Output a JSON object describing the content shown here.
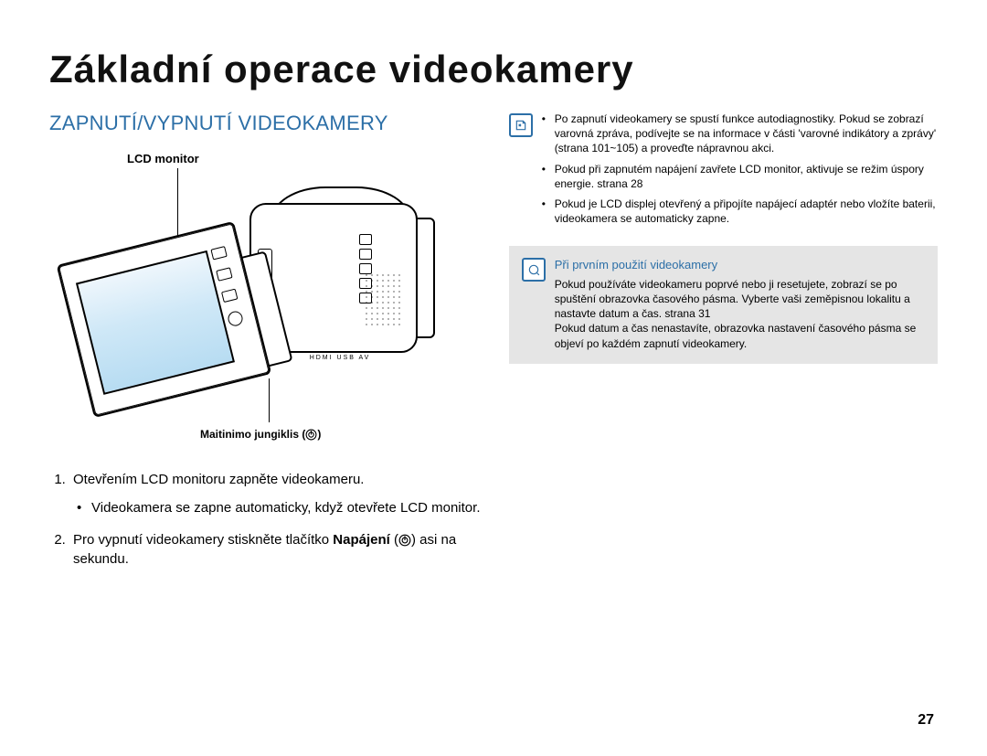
{
  "page": {
    "title": "Základní operace videokamery",
    "number": "27"
  },
  "section": {
    "heading": "ZAPNUTÍ/VYPNUTÍ VIDEOKAMERY"
  },
  "figure": {
    "lcd_label": "LCD monitor",
    "power_label_text": "Maitinimo jungiklis (",
    "power_label_close": ")",
    "port_text": "HDMI   USB   AV"
  },
  "steps": {
    "item1": {
      "text": "Otevřením LCD monitoru zapněte videokameru.",
      "sub1": "Videokamera se zapne automaticky, když otevřete LCD monitor."
    },
    "item2": {
      "pre": "Pro vypnutí videokamery stiskněte tlačítko ",
      "bold": "Napájení",
      "mid": " (",
      "post": ") asi na sekundu."
    }
  },
  "notes": {
    "n1": "Po zapnutí videokamery se spustí funkce autodiagnostiky. Pokud se zobrazí varovná zpráva, podívejte se na informace v části 'varovné indikátory a zprávy' (strana 101~105) a proveďte nápravnou akci.",
    "n2": "Pokud při zapnutém napájení zavřete LCD monitor, aktivuje se režim úspory energie. strana 28",
    "n3": "Pokud je LCD displej otevřený a připojíte napájecí adaptér nebo vložíte baterii, videokamera se automaticky zapne."
  },
  "tip": {
    "title": "Při prvním použití videokamery",
    "body": "Pokud používáte videokameru poprvé nebo ji resetujete, zobrazí se po spuštění obrazovka časového pásma. Vyberte vaši zeměpisnou lokalitu a nastavte datum a čas. strana 31\nPokud datum a čas nenastavíte, obrazovka nastavení časového pásma se objeví po každém zapnutí videokamery."
  }
}
